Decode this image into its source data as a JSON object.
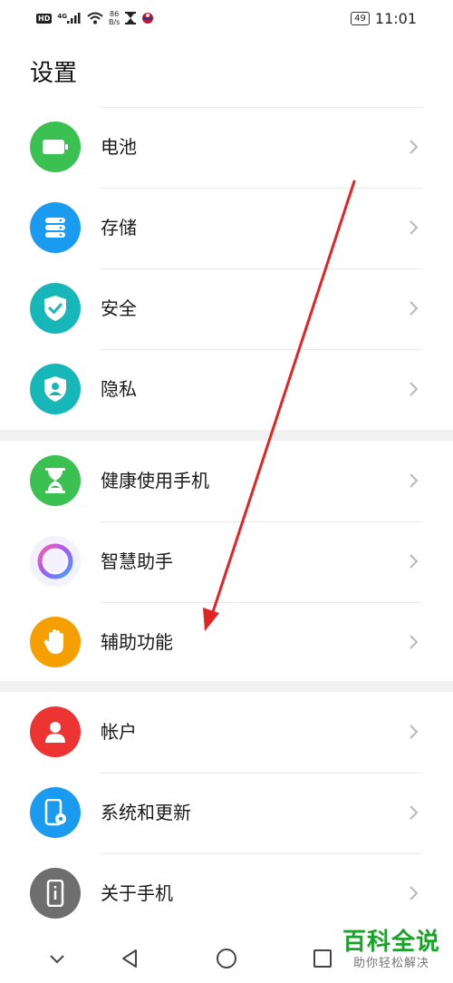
{
  "status_bar": {
    "hd": "HD",
    "network": "4G",
    "speed_value": "86",
    "speed_unit": "B/s",
    "battery": "49",
    "time": "11:01"
  },
  "page_title": "设置",
  "groups": [
    {
      "items": [
        {
          "label": "电池",
          "icon": "battery-icon",
          "color": "#3bc152"
        },
        {
          "label": "存储",
          "icon": "storage-icon",
          "color": "#1a9bf0"
        },
        {
          "label": "安全",
          "icon": "shield-check-icon",
          "color": "#17b7b9"
        },
        {
          "label": "隐私",
          "icon": "privacy-shield-icon",
          "color": "#17b7b9"
        }
      ]
    },
    {
      "items": [
        {
          "label": "健康使用手机",
          "icon": "hourglass-icon",
          "color": "#3bc152"
        },
        {
          "label": "智慧助手",
          "icon": "assistant-ring-icon",
          "color": "#f3f1fb"
        },
        {
          "label": "辅助功能",
          "icon": "hand-icon",
          "color": "#f5a000"
        }
      ]
    },
    {
      "items": [
        {
          "label": "帐户",
          "icon": "user-icon",
          "color": "#ee3333"
        },
        {
          "label": "系统和更新",
          "icon": "phone-gear-icon",
          "color": "#1a9bf0"
        },
        {
          "label": "关于手机",
          "icon": "phone-info-icon",
          "color": "#6e6e6e"
        }
      ]
    }
  ],
  "watermark": {
    "title": "百科全说",
    "subtitle": "助你轻松解决"
  }
}
